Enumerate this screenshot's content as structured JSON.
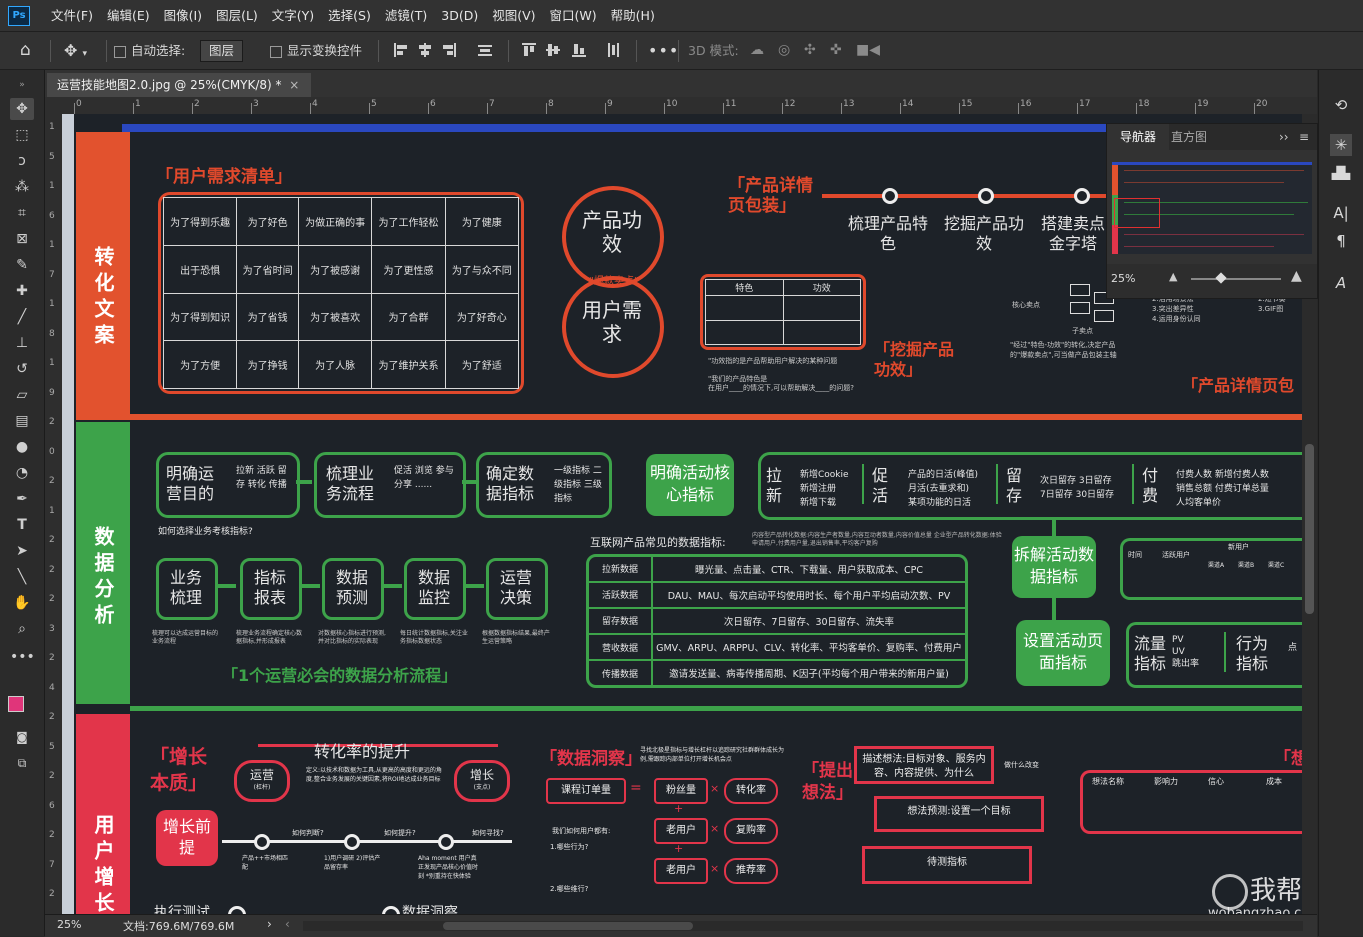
{
  "app": {
    "logo": "Ps"
  },
  "menu": [
    "文件(F)",
    "编辑(E)",
    "图像(I)",
    "图层(L)",
    "文字(Y)",
    "选择(S)",
    "滤镜(T)",
    "3D(D)",
    "视图(V)",
    "窗口(W)",
    "帮助(H)"
  ],
  "options": {
    "auto_select": "自动选择:",
    "layer_select": "图层",
    "show_transform": "显示变换控件",
    "mode3d": "3D 模式:"
  },
  "doc": {
    "tab_title": "运营技能地图2.0.jpg @ 25%(CMYK/8) *",
    "close": "×"
  },
  "ruler_h": [
    "0",
    "1",
    "2",
    "3",
    "4",
    "5",
    "6",
    "7",
    "8",
    "9",
    "10",
    "11",
    "12",
    "13",
    "14",
    "15",
    "16",
    "17",
    "18",
    "19",
    "20"
  ],
  "ruler_v": [
    "1",
    "5",
    "1",
    "6",
    "1",
    "7",
    "1",
    "8",
    "1",
    "9",
    "2",
    "0",
    "2",
    "1",
    "2",
    "2",
    "2",
    "3",
    "2",
    "4",
    "2",
    "5",
    "2",
    "6",
    "2",
    "7",
    "2"
  ],
  "status": {
    "zoom": "25%",
    "doc_size": "文档:769.6M/769.6M",
    "arrow": "›"
  },
  "navigator": {
    "tab_active": "导航器",
    "tab_inactive": "直方图",
    "zoom": "25%",
    "menu": "››"
  },
  "sections": {
    "s1": "转化文案",
    "s2": "数据分析",
    "s3": "用户增长"
  },
  "s1": {
    "needs_title": "「用户需求清单」",
    "needs": [
      [
        "为了得到乐趣",
        "为了好色",
        "为做正确的事",
        "为了工作轻松",
        "为了健康"
      ],
      [
        "出于恐惧",
        "为了省时间",
        "为了被感谢",
        "为了更性感",
        "为了与众不同"
      ],
      [
        "为了得到知识",
        "为了省钱",
        "为了被喜欢",
        "为了合群",
        "为了好奇心"
      ],
      [
        "为了方便",
        "为了挣钱",
        "为了人脉",
        "为了维护关系",
        "为了舒适"
      ]
    ],
    "circle1": "产品功效",
    "circle_mid": "\"爆款卖点\"",
    "circle2": "用户需求",
    "detail_title": "「产品详情页包装」",
    "steps": [
      "梳理产品特色",
      "挖掘产品功效",
      "搭建卖点金字塔"
    ],
    "feature_head": [
      "特色",
      "功效"
    ],
    "dig_title": "「挖掘产品功效」",
    "note1": "\"功效指的是产品帮助用户解决的某种问题",
    "note2": "\"我们的产品特色是",
    "note3": "在用户____的情况下,可以帮助解决____的问题?",
    "core": "核心卖点",
    "sub": "子卖点",
    "small1": "2.活用场景法",
    "small2": "3.突出差异性",
    "small3": "4.运用身份认同",
    "small4": "2.短节奏",
    "small5": "3.GIF图",
    "trans": "\"经过\"特色-功效\"的转化,决定产品的\"爆款卖点\",可当做产品包装主轴",
    "right_title": "「产品详情页包"
  },
  "s2": {
    "g1": "明确运营目的",
    "g1s": [
      "拉新",
      "活跃",
      "留存",
      "转化",
      "传播"
    ],
    "g2": "梳理业务流程",
    "g2s": [
      "促活",
      "浏览",
      "参与",
      "分享",
      "......"
    ],
    "g3": "确定数据指标",
    "g3s": [
      "一级指标",
      "二级指标",
      "三级指标"
    ],
    "q": "如何选择业务考核指标?",
    "core": "明确活动核心指标",
    "pull": "拉新",
    "pull_s": [
      "新增Cookie",
      "新增注册",
      "新增下载"
    ],
    "act": "促活",
    "act_s": [
      "产品的日活(峰值)",
      "月活(去重求和)",
      "某项功能的日活"
    ],
    "keep": "留存",
    "keep_s": [
      "次日留存 3日留存",
      "7日留存 30日留存"
    ],
    "pay": "付费",
    "pay_s": [
      "付费人数 新增付费人数",
      "销售总额 付费订单总量",
      "人均客单价"
    ],
    "flow": [
      "业务梳理",
      "指标报表",
      "数据预测",
      "数据监控",
      "运营决策"
    ],
    "flow_notes": [
      "梳理可以达成运营目标的业务流程",
      "梳理业务流程确定核心数据指标,并形成报表",
      "对数据核心指标进行预测,并对比指标的实际表现",
      "每日统计数据指标,关注业务指标数据状态",
      "根据数据指标结果,最终产生运营策略"
    ],
    "flow_title": "「1个运营必会的数据分析流程」",
    "table_title": "互联网产品常见的数据指标:",
    "table_sub": "内容型产品转化数据:内容生产者数量,内容互动者数量,内容价值总量 企业型产品转化数据:体验申请用户,付费用户量,退出销售率,平均客户复购",
    "table": [
      [
        "拉新数据",
        "曝光量、点击量、CTR、下载量、用户获取成本、CPC"
      ],
      [
        "活跃数据",
        "DAU、MAU、每次启动平均使用时长、每个用户平均启动次数、PV"
      ],
      [
        "留存数据",
        "次日留存、7日留存、30日留存、流失率"
      ],
      [
        "营收数据",
        "GMV、ARPU、ARPPU、CLV、转化率、平均客单价、复购率、付费用户"
      ],
      [
        "传播数据",
        "邀请发送量、病毒传播周期、K因子(平均每个用户带来的新用户量)"
      ]
    ],
    "split": "拆解活动数据指标",
    "page": "设置活动页面指标",
    "traffic": "流量指标",
    "traffic_s": [
      "PV",
      "UV",
      "跳出率"
    ],
    "behavior": "行为指标",
    "dot": "点",
    "mini_head": [
      "时间",
      "活跃用户",
      "新用户"
    ],
    "mini_sub": [
      "渠道A",
      "渠道B",
      "渠道C"
    ]
  },
  "s3": {
    "essence": "「增长本质」",
    "conv": "转化率的提升",
    "op": "运营",
    "op_s": "(杠杆)",
    "grow": "增长",
    "grow_s": "(支点)",
    "def": "定义:以技术和数据为工具,从更高的高度和更远的角度,整合业务发展的关键因素,将ROI地达成业务目标",
    "premise": "增长前提",
    "p_labels": [
      "如何判断?",
      "如何提升?",
      "如何寻找?"
    ],
    "p_notes": [
      "产品++市场相匹配",
      "1)用户调研 2)评估产品留存率",
      "Aha moment 用户真正发现产品核心价值时刻 *别重持在快体验"
    ],
    "insight": "「数据洞察」",
    "insight_note": "寻找北极星指标与增长杠杆以追踪研究社群群体成长为例,需跟踪内部单位打开增长机会点",
    "course": "课程订单量",
    "eq": "=",
    "fans": "粉丝量",
    "conv_rate": "转化率",
    "old1": "老用户",
    "repurchase": "复购率",
    "old2": "老用户",
    "referral": "推荐率",
    "times": "×",
    "plus": "+",
    "we": "我们如何用户都有:",
    "q1": "1.哪些行为?",
    "q2": "2.哪些维行?",
    "hypo": "「提出想法」",
    "describe": "描述想法:目标对象、服务内容、内容提供、为什么",
    "why": "做什么改变",
    "predict": "想法预测:设置一个目标",
    "measure": "待测指标",
    "cols": [
      "想法名称",
      "影响力",
      "信心",
      "成本"
    ],
    "test": "执行测试",
    "data_ins": "数据洞察",
    "right": "「想"
  },
  "watermark": {
    "brand": "我帮找网",
    "url": "wobangzhao.com"
  }
}
